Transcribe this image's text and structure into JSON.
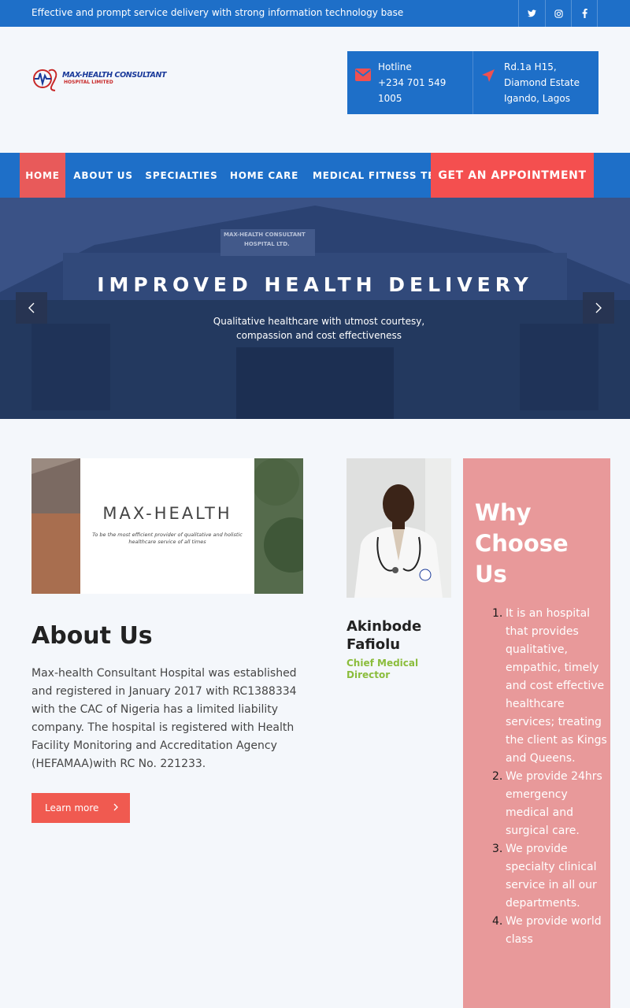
{
  "topbar": {
    "tagline": "Effective and prompt service delivery with strong information technology base",
    "social": [
      {
        "icon": "twitter-icon",
        "glyph": "🐦"
      },
      {
        "icon": "instagram-icon",
        "glyph": "◎"
      },
      {
        "icon": "facebook-icon",
        "glyph": "f"
      }
    ]
  },
  "header": {
    "logo_text": "MAX-HEALTH CONSULTANT",
    "logo_sub": "HOSPITAL LIMITED",
    "hotline_label": "Hotline",
    "hotline_line1": "+234 701 549",
    "hotline_line2": "1005",
    "address_line1": "Rd.1a H15,",
    "address_line2": "Diamond Estate",
    "address_line3": "Igando, Lagos"
  },
  "nav": {
    "items": [
      "HOME",
      "ABOUT US",
      "SPECIALTIES",
      "HOME CARE",
      "MEDICAL FITNESS TEST"
    ],
    "appointment": "GET AN APPOINTMENT"
  },
  "hero": {
    "title": "IMPROVED HEALTH DELIVERY",
    "subtitle_line1": "Qualitative healthcare with utmost courtesy,",
    "subtitle_line2": "compassion and cost effectiveness",
    "sign_line1": "MAX-HEALTH CONSULTANT",
    "sign_line2": "HOSPITAL LTD."
  },
  "about": {
    "image_title": "MAX-HEALTH",
    "image_tagline1": "To be the most efficient provider of qualitative and holistic",
    "image_tagline2": "healthcare service of all times",
    "title": "About Us",
    "text": "Max-health Consultant Hospital was established and registered in January 2017 with RC1388334 with the CAC of Nigeria has a limited liability company. The hospital is registered with Health Facility Monitoring and Accreditation Agency (HEFAMAA)with RC No. 221233.",
    "button": "Learn more"
  },
  "doctor": {
    "name_line1": "Akinbode",
    "name_line2": "Fafiolu",
    "role_line1": "Chief Medical",
    "role_line2": "Director"
  },
  "why": {
    "title": "Why Choose Us",
    "items": [
      {
        "num": "1.",
        "text": "It is an hospital that provides qualitative, empathic, timely and cost effective healthcare services; treating the client as Kings and Queens."
      },
      {
        "num": "2.",
        "text": "We provide 24hrs emergency medical and surgical care."
      },
      {
        "num": "3.",
        "text": "We provide specialty clinical service in all our departments."
      },
      {
        "num": "4.",
        "text": "We provide world class"
      }
    ]
  },
  "colors": {
    "primary": "#1e6fc8",
    "accent": "#f44f4f",
    "why_bg": "#e8999a",
    "role": "#8bbd3c"
  }
}
